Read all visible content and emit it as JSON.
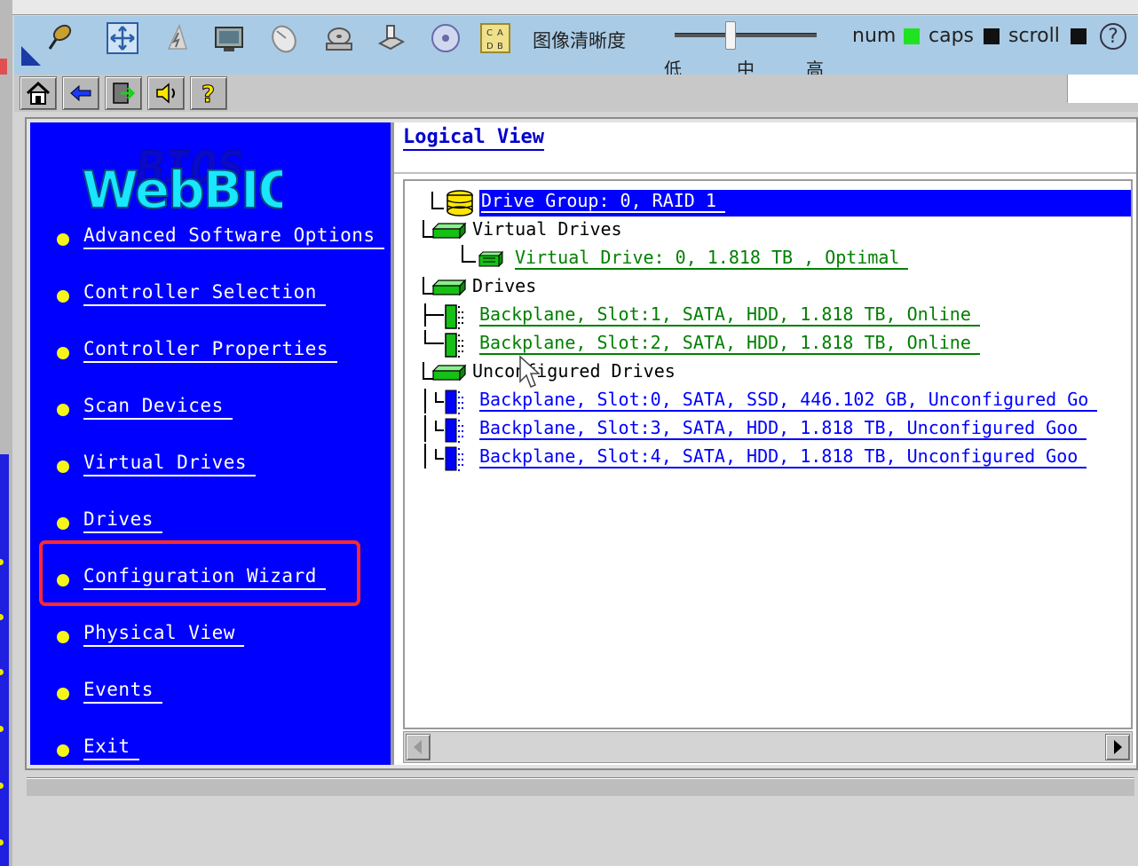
{
  "kvm_toolbar": {
    "clarity_label": "图像清晰度",
    "level_low": "低",
    "level_mid": "中",
    "level_high": "高",
    "num_label": "num",
    "caps_label": "caps",
    "scroll_label": "scroll",
    "help_glyph": "?",
    "num_state_color": "#1ee31e",
    "caps_state_color": "#111111",
    "scroll_state_color": "#111111"
  },
  "logo_text": "WebBIOS",
  "nav": {
    "items": [
      {
        "label": "Advanced Software Options"
      },
      {
        "label": "Controller Selection"
      },
      {
        "label": "Controller Properties"
      },
      {
        "label": "Scan Devices"
      },
      {
        "label": "Virtual Drives"
      },
      {
        "label": "Drives"
      },
      {
        "label": "Configuration Wizard"
      },
      {
        "label": "Physical View"
      },
      {
        "label": "Events"
      },
      {
        "label": "Exit"
      }
    ],
    "highlighted": "Configuration Wizard"
  },
  "logical_view": {
    "title": "Logical View",
    "rows": [
      {
        "text": "Drive Group: 0, RAID 1",
        "kind": "drive-group"
      },
      {
        "text": "Virtual Drives",
        "kind": "section"
      },
      {
        "text": "Virtual Drive: 0, 1.818 TB , Optimal",
        "kind": "virtual-drive"
      },
      {
        "text": "Drives",
        "kind": "section"
      },
      {
        "text": "Backplane, Slot:1, SATA, HDD, 1.818 TB, Online",
        "kind": "online-drive"
      },
      {
        "text": "Backplane, Slot:2, SATA, HDD, 1.818 TB, Online",
        "kind": "online-drive"
      },
      {
        "text": "Unconfigured Drives",
        "kind": "section"
      },
      {
        "text": "Backplane, Slot:0, SATA, SSD, 446.102 GB, Unconfigured Go",
        "kind": "unconfigured-drive"
      },
      {
        "text": "Backplane, Slot:3, SATA, HDD, 1.818 TB, Unconfigured Goo",
        "kind": "unconfigured-drive"
      },
      {
        "text": "Backplane, Slot:4, SATA, HDD, 1.818 TB, Unconfigured Goo",
        "kind": "unconfigured-drive"
      }
    ]
  },
  "colors": {
    "nav_background": "#0000ff",
    "highlight_border": "#ff2a2a",
    "online_text": "#008000",
    "unconfigured_text": "#0000ff",
    "selected_row": "#0000ff"
  }
}
